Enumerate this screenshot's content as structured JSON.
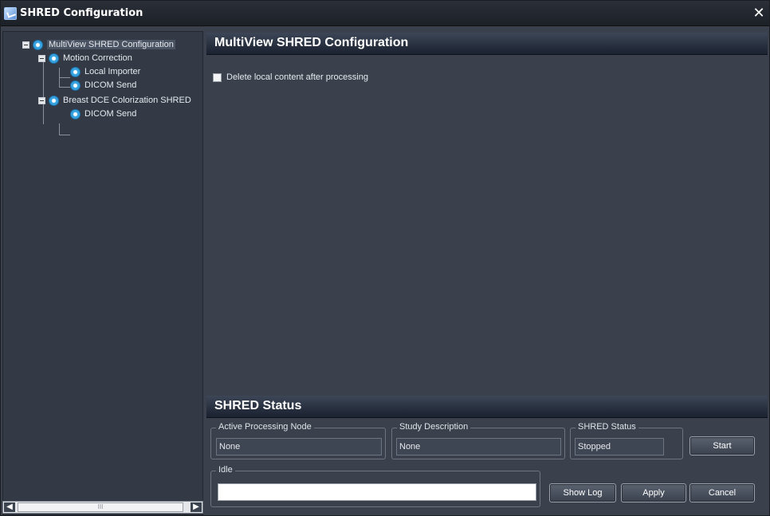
{
  "window": {
    "title": "SHRED Configuration"
  },
  "tree": {
    "root": "MultiView SHRED Configuration",
    "motion_correction": "Motion Correction",
    "local_importer": "Local Importer",
    "dicom_send_1": "DICOM Send",
    "breast_dce": "Breast DCE Colorization SHRED",
    "dicom_send_2": "DICOM Send"
  },
  "main": {
    "header": "MultiView SHRED Configuration",
    "delete_local_label": "Delete local content after processing"
  },
  "status": {
    "header": "SHRED Status",
    "active_node_label": "Active Processing Node",
    "active_node_value": "None",
    "study_desc_label": "Study Description",
    "study_desc_value": "None",
    "shred_status_label": "SHRED Status",
    "shred_status_value": "Stopped",
    "idle_label": "Idle"
  },
  "buttons": {
    "start": "Start",
    "show_log": "Show Log",
    "apply": "Apply",
    "cancel": "Cancel"
  },
  "scrollbar": {
    "thumb_grip": "III"
  },
  "icons": {
    "close": "close-icon",
    "app": "shred-app-icon",
    "node": "gear-node-icon"
  }
}
